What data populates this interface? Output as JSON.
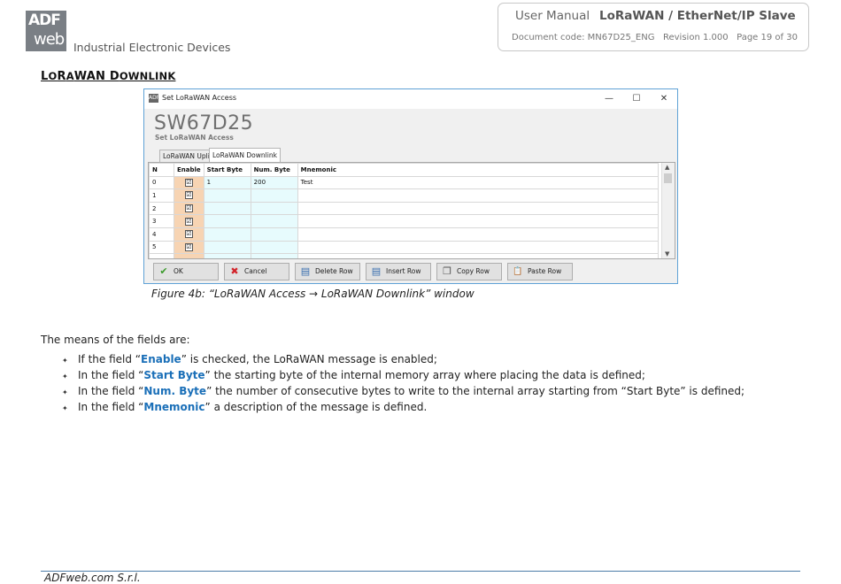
{
  "header": {
    "logo_line1": "ADF",
    "logo_line2": "web",
    "tagline": "Industrial Electronic Devices",
    "user_manual": "User Manual",
    "product": "LoRaWAN / EtherNet/IP Slave",
    "doc_info": "Document code: MN67D25_ENG   Revision 1.000   Page 19 of 30"
  },
  "section_title": {
    "p1": "L",
    "p2": "O",
    "p3": "R",
    "p4": "A",
    "p5": "WAN D",
    "p6": "OWNLINK"
  },
  "window": {
    "title": "Set LoRaWAN Access",
    "icon_text": "ADF",
    "minimize": "—",
    "maximize": "☐",
    "close": "✕",
    "app_title": "SW67D25",
    "subtitle": "Set LoRaWAN Access",
    "tabs": [
      "LoRaWAN Uplink",
      "LoRaWAN Downlink"
    ],
    "columns": [
      "N",
      "Enable",
      "Start Byte",
      "Num. Byte",
      "Mnemonic"
    ],
    "rows": [
      {
        "n": "0",
        "start": "1",
        "num": "200",
        "mnemonic": "Test",
        "enabled": "☑"
      },
      {
        "n": "1",
        "start": "",
        "num": "",
        "mnemonic": "",
        "enabled": "☑"
      },
      {
        "n": "2",
        "start": "",
        "num": "",
        "mnemonic": "",
        "enabled": "☑"
      },
      {
        "n": "3",
        "start": "",
        "num": "",
        "mnemonic": "",
        "enabled": "☑"
      },
      {
        "n": "4",
        "start": "",
        "num": "",
        "mnemonic": "",
        "enabled": "☑"
      },
      {
        "n": "5",
        "start": "",
        "num": "",
        "mnemonic": "",
        "enabled": "☑"
      }
    ],
    "buttons": {
      "ok": "OK",
      "ok_icon": "✔",
      "cancel": "Cancel",
      "cancel_icon": "✖",
      "delete": "Delete Row",
      "delete_icon": "▤",
      "insert": "Insert Row",
      "insert_icon": "▤",
      "copy": "Copy Row",
      "copy_icon": "❐",
      "paste": "Paste Row",
      "paste_icon": "📋"
    },
    "scroll_up": "▲",
    "scroll_down": "▼"
  },
  "caption": "Figure 4b: “LoRaWAN Access → LoRaWAN Downlink” window",
  "intro": "The means of the fields are:",
  "bullet_marker": "✦",
  "bullets": [
    {
      "pre": "If the field “",
      "field": "Enable",
      "post": "” is checked, the LoRaWAN message is enabled;"
    },
    {
      "pre": "In the field “",
      "field": "Start Byte",
      "post": "” the starting byte of the internal memory array where placing the data is defined;"
    },
    {
      "pre": "In the field “",
      "field": "Num. Byte",
      "post": "” the number of consecutive bytes to write to the internal array starting from “Start Byte” is defined;"
    },
    {
      "pre": "In the field “",
      "field": "Mnemonic",
      "post": "” a description of the message is defined."
    }
  ],
  "footer": "ADFweb.com S.r.l."
}
